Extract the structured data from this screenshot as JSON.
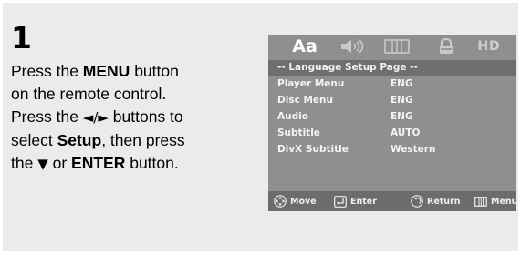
{
  "step": {
    "number": "1"
  },
  "instructions": {
    "l1_pre": "Press the ",
    "l1_bold": "MENU",
    "l1_post": " button",
    "l2": "on the remote control.",
    "l3_pre": "Press the ",
    "l3_sym": "◄/►",
    "l3_post": " buttons to",
    "l4_pre": "select ",
    "l4_bold": "Setup",
    "l4_post": ", then press",
    "l5_pre": "the ",
    "l5_sym": "▼",
    "l5_mid": " or ",
    "l5_bold": "ENTER",
    "l5_post": " button."
  },
  "osd": {
    "tabs": {
      "language": "Aa",
      "hd": "HD"
    },
    "header": "-- Language Setup Page --",
    "rows": [
      {
        "label": "Player Menu",
        "value": "ENG"
      },
      {
        "label": "Disc Menu",
        "value": "ENG"
      },
      {
        "label": "Audio",
        "value": "ENG"
      },
      {
        "label": "Subtitle",
        "value": "AUTO"
      },
      {
        "label": "DivX Subtitle",
        "value": "Western"
      }
    ],
    "footer": {
      "move": "Move",
      "enter": "Enter",
      "return": "Return",
      "menu": "Menu"
    },
    "colors": {
      "background": "#8f8f8f",
      "header": "#6f6f6f",
      "footer": "#6c6c6c"
    }
  }
}
